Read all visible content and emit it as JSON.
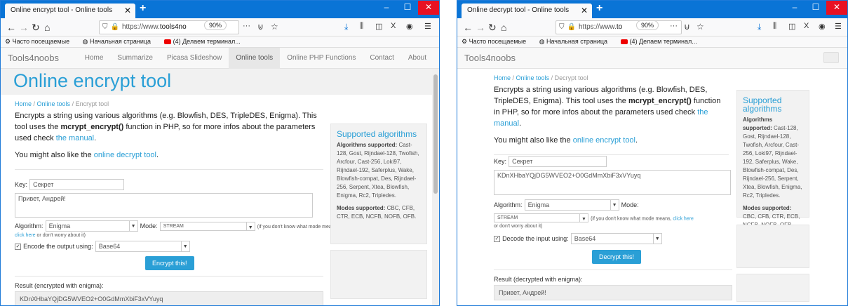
{
  "left": {
    "tab_title": "Online encrypt tool - Online tools",
    "url_prefix": "https://www.",
    "url_domain": "tools4no",
    "zoom": "90%",
    "site_brand": "Tools4noobs",
    "menu": [
      "Home",
      "Summarize",
      "Picasa Slideshow",
      "Online tools",
      "Online PHP Functions",
      "Contact",
      "About"
    ],
    "page_title": "Online encrypt tool",
    "crumb": [
      "Home",
      "Online tools",
      "Encrypt tool"
    ],
    "intro_1": "Encrypts a string using various algorithms (e.g. Blowfish, DES, TripleDES, Enigma). This tool uses the ",
    "intro_func": "mcrypt_encrypt()",
    "intro_2": " function in PHP, so for more infos about the parameters used check ",
    "intro_link": "the manual",
    "intro_end": ".",
    "like_text": "You might also like the ",
    "like_link": "online decrypt tool",
    "like_end": ".",
    "key_label": "Key:",
    "key_value": "Секрет",
    "text_value": "Привет, Андрей!",
    "algo_label": "Algorithm:",
    "algo_value": "Enigma",
    "mode_label": "Mode:",
    "mode_value": "STREAM",
    "mode_hint_1": "(if you don't know what mode means, ",
    "mode_hint_link": "click here",
    "mode_hint_2": " or don't worry about it)",
    "encode_label": "Encode the output using:",
    "encode_value": "Base64",
    "button": "Encrypt this!",
    "result_label": "Result (encrypted with enigma):",
    "result_value": "KDnXHbaYQjDG5WVEO2+O0GdMmXbiF3xVYuyq"
  },
  "right": {
    "tab_title": "Online decrypt tool - Online tools",
    "url_prefix": "https://www.",
    "url_domain": "to",
    "zoom": "90%",
    "site_brand": "Tools4noobs",
    "crumb": [
      "Home",
      "Online tools",
      "Decrypt tool"
    ],
    "intro_1": "Encrypts a string using various algorithms (e.g. Blowfish, DES, TripleDES, Enigma). This tool uses the ",
    "intro_func": "mcrypt_encrypt()",
    "intro_2": " function in PHP, so for more infos about the parameters used check ",
    "intro_link": "the manual",
    "intro_end": ".",
    "like_text": "You might also like the ",
    "like_link": "online encrypt tool",
    "like_end": ".",
    "key_label": "Key:",
    "key_value": "Секрет",
    "text_value": "KDnXHbaYQjDG5WVEO2+O0GdMmXbiF3xVYuyq",
    "algo_label": "Algorithm:",
    "algo_value": "Enigma",
    "mode_label": "Mode:",
    "mode_value": "STREAM",
    "mode_hint_1": "(if you don't know what mode means, ",
    "mode_hint_link": "click here",
    "mode_hint_2": " or don't worry about it)",
    "decode_label": "Decode the input using:",
    "decode_value": "Base64",
    "button": "Decrypt this!",
    "result_label": "Result (decrypted with enigma):",
    "result_value": "Привет, Андрей!"
  },
  "bookmarks": [
    "Часто посещаемые",
    "Начальная страница",
    "(4) Делаем терминал..."
  ],
  "sidebar": {
    "title": "Supported algorithms",
    "algos_label": "Algorithms supported:",
    "algos": "Cast-128, Gost, Rijndael-128, Twofish, Arcfour, Cast-256, Loki97, Rijndael-192, Saferplus, Wake, Blowfish-compat, Des, Rijndael-256, Serpent, Xtea, Blowfish, Enigma, Rc2, Tripledes.",
    "modes_label": "Modes supported:",
    "modes": "CBC, CFB, CTR, ECB, NCFB, NOFB, OFB."
  },
  "colors": {
    "accent": "#2a9fd6",
    "titlebar": "#0a74d6",
    "close": "#e81123"
  }
}
